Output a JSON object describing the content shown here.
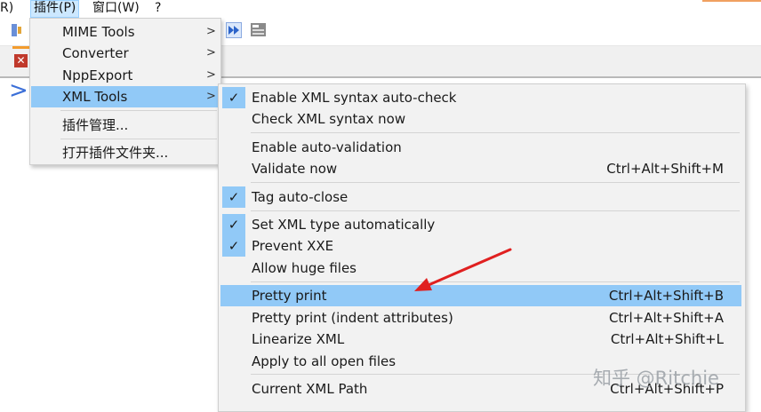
{
  "menubar": {
    "items": [
      "R)",
      "插件(P)",
      "窗口(W)",
      "?"
    ]
  },
  "plugins_menu": {
    "items": [
      {
        "label": "MIME Tools",
        "submenu": true
      },
      {
        "label": "Converter",
        "submenu": true
      },
      {
        "label": "NppExport",
        "submenu": true
      },
      {
        "label": "XML Tools",
        "submenu": true,
        "highlighted": true
      },
      {
        "label": "插件管理...",
        "submenu": false
      },
      {
        "label": "打开插件文件夹...",
        "submenu": false
      }
    ],
    "arrow_glyph": ">"
  },
  "xml_tools_menu": {
    "items": [
      {
        "label": "Enable XML syntax auto-check",
        "shortcut": "",
        "checked": true
      },
      {
        "label": "Check XML syntax now",
        "shortcut": "",
        "checked": false
      },
      {
        "label": "Enable auto-validation",
        "shortcut": "",
        "checked": false
      },
      {
        "label": "Validate now",
        "shortcut": "Ctrl+Alt+Shift+M",
        "checked": false
      },
      {
        "label": "Tag auto-close",
        "shortcut": "",
        "checked": true
      },
      {
        "label": "Set XML type automatically",
        "shortcut": "",
        "checked": true
      },
      {
        "label": "Prevent XXE",
        "shortcut": "",
        "checked": true
      },
      {
        "label": "Allow huge files",
        "shortcut": "",
        "checked": false
      },
      {
        "label": "Pretty print",
        "shortcut": "Ctrl+Alt+Shift+B",
        "checked": false,
        "highlighted": true
      },
      {
        "label": "Pretty print (indent attributes)",
        "shortcut": "Ctrl+Alt+Shift+A",
        "checked": false
      },
      {
        "label": "Linearize XML",
        "shortcut": "Ctrl+Alt+Shift+L",
        "checked": false
      },
      {
        "label": "Apply to all open files",
        "shortcut": "",
        "checked": false
      },
      {
        "label": "Current XML Path",
        "shortcut": "Ctrl+Alt+Shift+P",
        "checked": false
      }
    ],
    "check_glyph": "✓"
  },
  "editor": {
    "prompt_glyph": ">"
  },
  "watermark": "知乎 @Ritchie",
  "colors": {
    "menu_bg": "#f2f2f2",
    "highlight": "#91c9f7",
    "arrow": "#e02020",
    "tab_accent": "#f39c2e"
  },
  "icons": [
    "toolbar-icon",
    "macro-fast-forward-icon",
    "macro-save-icon",
    "close-tab-icon",
    "submenu-arrow-icon",
    "checkmark-icon"
  ]
}
